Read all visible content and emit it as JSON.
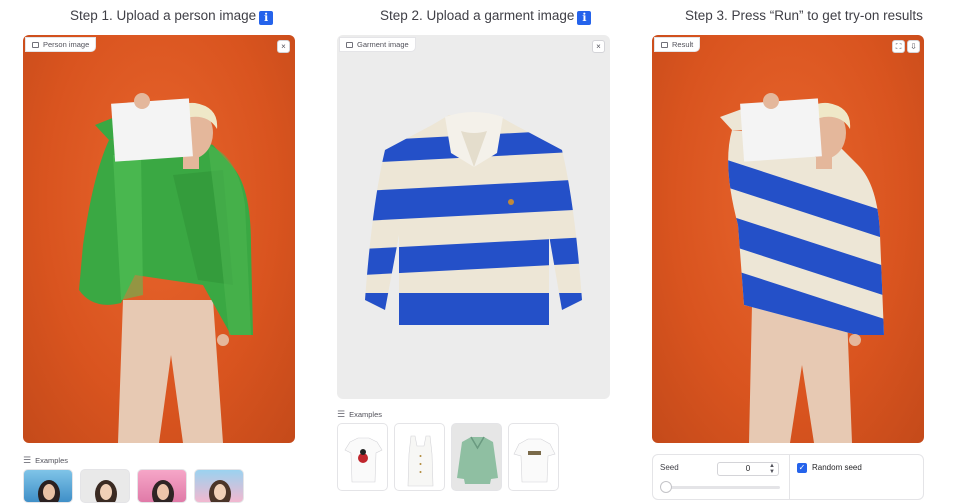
{
  "steps": {
    "step1": "Step 1. Upload a person image",
    "step2": "Step 2. Upload a garment image",
    "step3": "Step 3. Press “Run” to get try-on results",
    "info_icon": "ℹ"
  },
  "person_panel": {
    "label": "Person image",
    "close_icon": "×"
  },
  "garment_panel": {
    "label": "Garment image",
    "close_icon": "×"
  },
  "result_panel": {
    "label": "Result",
    "fullscreen_icon": "⛶",
    "download_icon": "⇩"
  },
  "person_examples": {
    "label": "Examples",
    "count_visible": 4
  },
  "garment_examples": {
    "label": "Examples",
    "count_visible": 4
  },
  "settings": {
    "seed_label": "Seed",
    "seed_value": "0",
    "seed_slider_value": 0,
    "random_seed_label": "Random seed",
    "random_seed_checked": true
  },
  "colors": {
    "orange_background": "#d9541f",
    "green_jacket": "#3aa843",
    "stripe_blue": "#2450c8",
    "stripe_cream": "#ede6d6",
    "checkbox_blue": "#2563eb"
  }
}
